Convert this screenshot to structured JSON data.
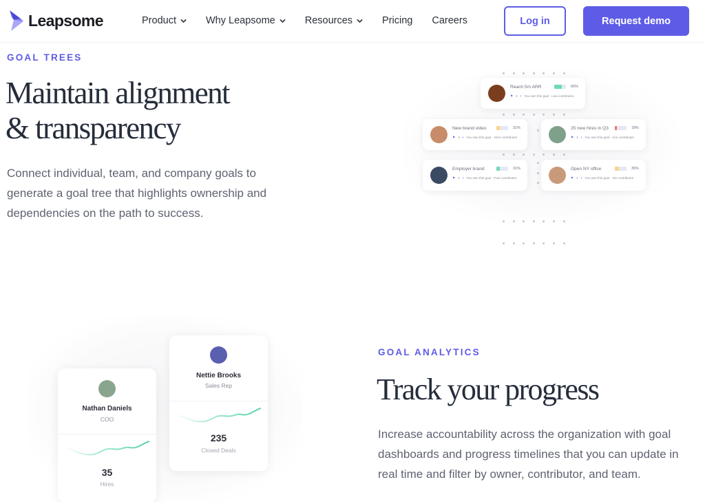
{
  "nav": {
    "logo_text": "Leapsome",
    "items": [
      {
        "label": "Product",
        "has_dropdown": true
      },
      {
        "label": "Why Leapsome",
        "has_dropdown": true
      },
      {
        "label": "Resources",
        "has_dropdown": true
      },
      {
        "label": "Pricing",
        "has_dropdown": false
      },
      {
        "label": "Careers",
        "has_dropdown": false
      }
    ],
    "login_label": "Log in",
    "demo_label": "Request demo"
  },
  "colors": {
    "brand": "#5e5ce6",
    "heading": "#262d3b",
    "body": "#5f6370",
    "progress_green": "#6fd9bb",
    "progress_orange": "#fbd38d",
    "progress_red": "#f2737b"
  },
  "goal_trees": {
    "eyebrow": "GOAL TREES",
    "headline_line1": "Maintain alignment",
    "headline_line2": "& transparency",
    "body": "Connect individual, team, and company goals to generate a goal tree that highlights ownership and dependencies on the path to success.",
    "goals": [
      {
        "title": "Reach 5m ARR",
        "progress": 65,
        "progress_label": "65%",
        "color": "#6fd9bb",
        "count": "4",
        "meta": "You own this goal · Lisa contributes",
        "avatar": "#7a3e1f"
      },
      {
        "title": "New brand video",
        "progress": 31,
        "progress_label": "31%",
        "color": "#fbd38d",
        "count": "3",
        "meta": "You own this goal · John contributes",
        "avatar": "#c88c6a"
      },
      {
        "title": "25 new hires in Q3",
        "progress": 18,
        "progress_label": "18%",
        "color": "#f2737b",
        "count": "2",
        "meta": "You own this goal · Ann contributes",
        "avatar": "#7fa08a"
      },
      {
        "title": "Employer brand",
        "progress": 31,
        "progress_label": "31%",
        "color": "#6fd9bb",
        "count": "2",
        "meta": "You own this goal · Paul contributes",
        "avatar": "#3b4a63"
      },
      {
        "title": "Open NY office",
        "progress": 35,
        "progress_label": "35%",
        "color": "#fbd38d",
        "count": "1",
        "meta": "You own this goal · Jim contributes",
        "avatar": "#c99a7a"
      }
    ]
  },
  "goal_analytics": {
    "eyebrow": "GOAL ANALYTICS",
    "headline": "Track your progress",
    "body": "Increase accountability across the organization with goal dashboards and progress timelines that you can update in real time and filter by owner, contributor, and team.",
    "people": [
      {
        "name": "Nathan Daniels",
        "role": "COO",
        "value": "35",
        "metric": "Hires",
        "avatar": "#8aa58d"
      },
      {
        "name": "Nettie Brooks",
        "role": "Sales Rep",
        "value": "235",
        "metric": "Closed Deals",
        "avatar": "#5a5fb0"
      }
    ]
  }
}
